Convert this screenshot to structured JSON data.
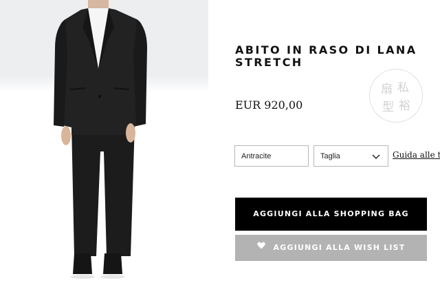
{
  "product": {
    "title": "ABITO IN RASO DI LANA STRETCH",
    "price": "EUR 920,00"
  },
  "options": {
    "color_value": "Antracite",
    "size_placeholder": "Taglia",
    "size_guide_link": "Guida alle taglie"
  },
  "actions": {
    "add_to_bag_label": "AGGIUNGI ALLA SHOPPING BAG",
    "add_to_wishlist_label": "AGGIUNGI ALLA WISH LIST"
  },
  "icons": {
    "size_dropdown": "chevron-down-icon",
    "wishlist": "heart-icon"
  },
  "colors": {
    "primary_button": "#000000",
    "secondary_button": "#b3b3b3",
    "suit": "#1e1e1f"
  }
}
